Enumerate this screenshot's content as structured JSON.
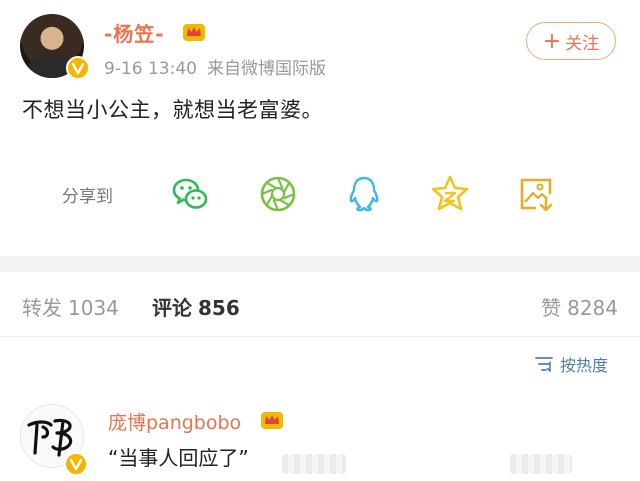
{
  "post": {
    "author": "-杨笠-",
    "date": "9-16 13:40",
    "source": "来自微博国际版",
    "follow_label": "关注",
    "follow_plus": "+",
    "text": "不想当小公主，就想当老富婆。"
  },
  "share": {
    "label": "分享到",
    "targets": [
      "wechat-icon",
      "moments-icon",
      "qq-icon",
      "qzone-icon",
      "save-image-icon"
    ]
  },
  "tabs": {
    "repost": {
      "label": "转发",
      "count": "1034"
    },
    "comment": {
      "label": "评论",
      "count": "856"
    },
    "like": {
      "label": "赞",
      "count": "8284"
    }
  },
  "sort": {
    "label": "按热度"
  },
  "comment": {
    "author": "庞博pangbobo",
    "text": "“当事人回应了”"
  },
  "colors": {
    "accent": "#eb7350",
    "link": "#507daf",
    "verify_badge": "#f7b500",
    "wechat": "#2bbc55",
    "moments": "#7ac143",
    "qq": "#42b6e8",
    "qzone": "#f7c21a"
  }
}
